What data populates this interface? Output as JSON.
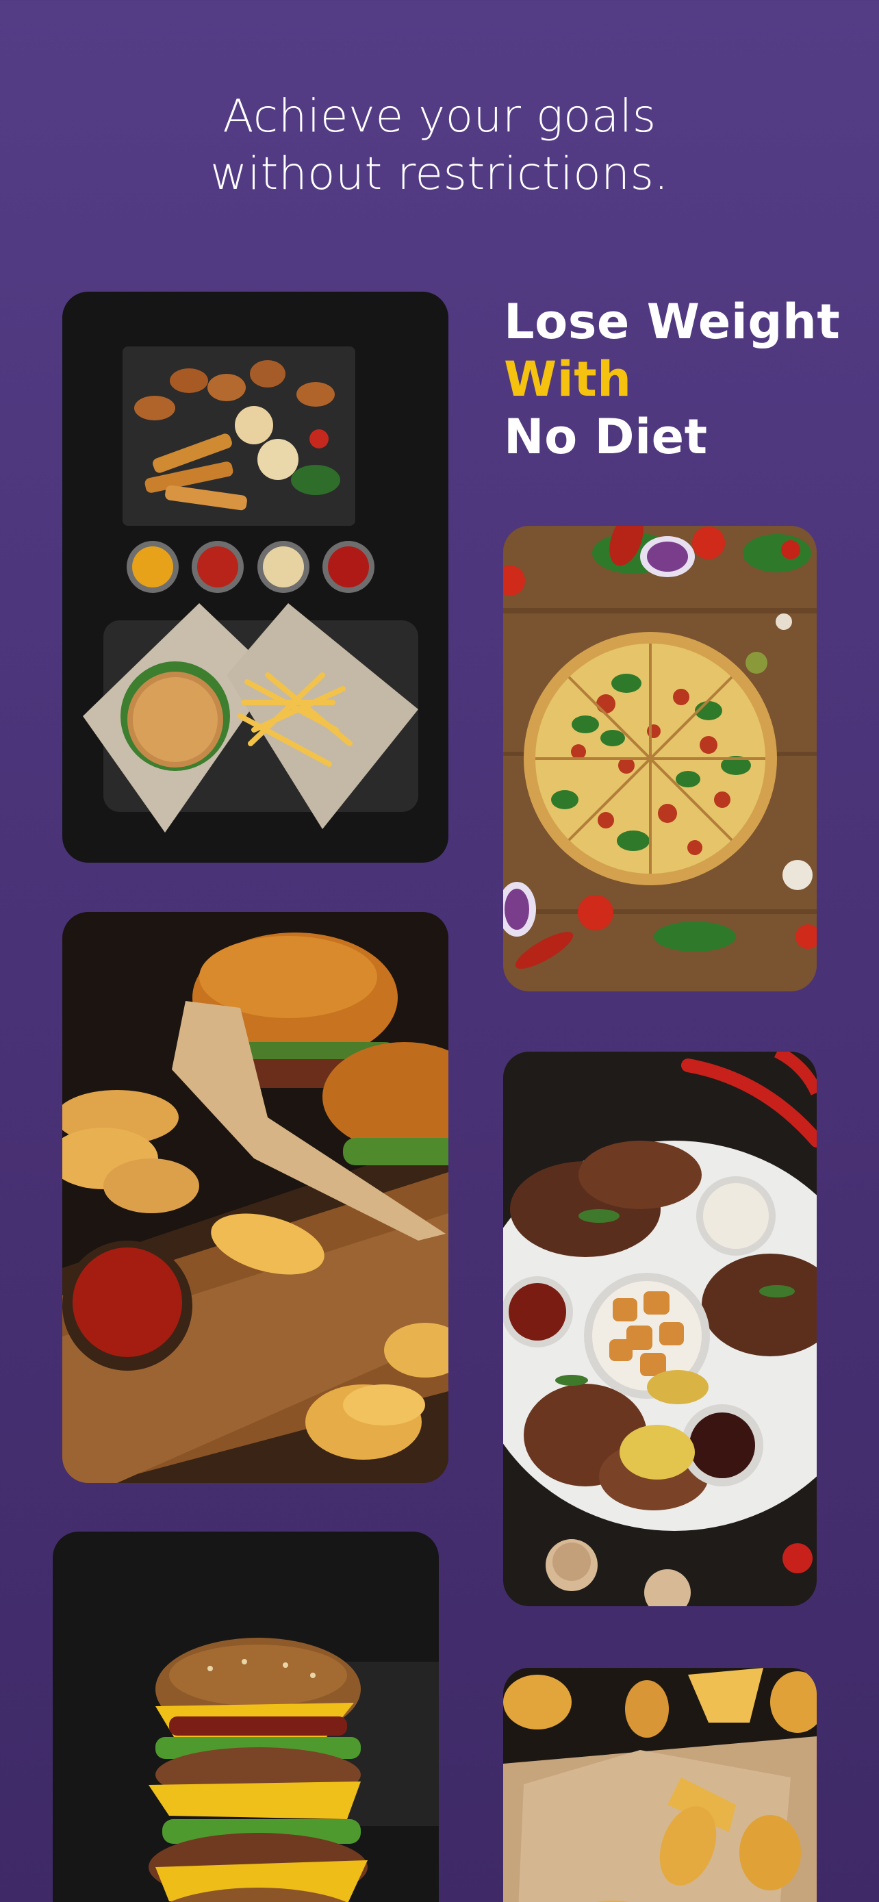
{
  "headline": {
    "line1": "Achieve your goals",
    "line2": "without restrictions."
  },
  "slogan": {
    "line1": "Lose Weight",
    "line2": "With",
    "line3": "No Diet"
  },
  "colors": {
    "background_top": "#553d86",
    "background_bottom": "#3f2a67",
    "accent": "#f5c20f",
    "text": "#ffffff"
  },
  "photos": [
    {
      "name": "chicken-burger-fries-photo"
    },
    {
      "name": "pizza-photo"
    },
    {
      "name": "burger-wedges-photo"
    },
    {
      "name": "grill-platter-photo"
    },
    {
      "name": "stacked-burger-photo"
    },
    {
      "name": "potato-wedges-photo"
    }
  ]
}
